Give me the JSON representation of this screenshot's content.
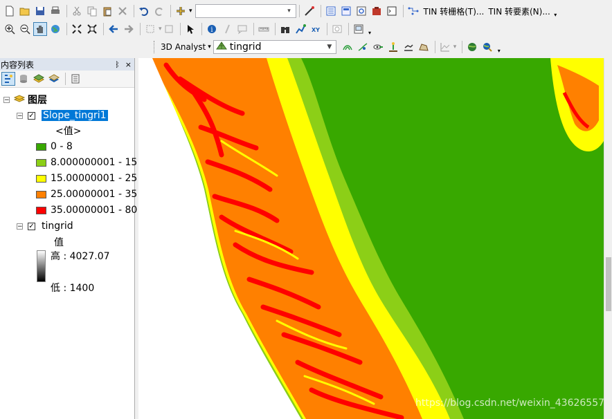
{
  "toolbar": {
    "tin_to_raster_label": "TIN 转栅格(T)...",
    "tin_to_features_label": "TIN 转要素(N)...",
    "analyst_label": "3D Analyst",
    "layer_combo_value": "tingrid",
    "scale_combo_value": ""
  },
  "toc": {
    "title": "内容列表",
    "pin": "ᛒ",
    "close": "×",
    "root_label": "图层",
    "layers": [
      {
        "name": "Slope_tingri1",
        "field": "<值>",
        "classes": [
          {
            "label": "0 - 8",
            "color": "#38a800"
          },
          {
            "label": "8.000000001 - 15",
            "color": "#8ccf17"
          },
          {
            "label": "15.00000001 - 25",
            "color": "#ffff00"
          },
          {
            "label": "25.00000001 - 35",
            "color": "#ff8000"
          },
          {
            "label": "35.00000001 - 80",
            "color": "#ff0000"
          }
        ]
      },
      {
        "name": "tingrid",
        "field": "值",
        "high": "高 : 4027.07",
        "low": "低 : 1400"
      }
    ]
  },
  "map": {
    "watermark": "https://blog.csdn.net/weixin_43626557"
  },
  "colors": {
    "slope_0_8": "#38a800",
    "slope_8_15": "#8ccf17",
    "slope_15_25": "#ffff00",
    "slope_25_35": "#ff8000",
    "slope_35_80": "#ff0000"
  }
}
